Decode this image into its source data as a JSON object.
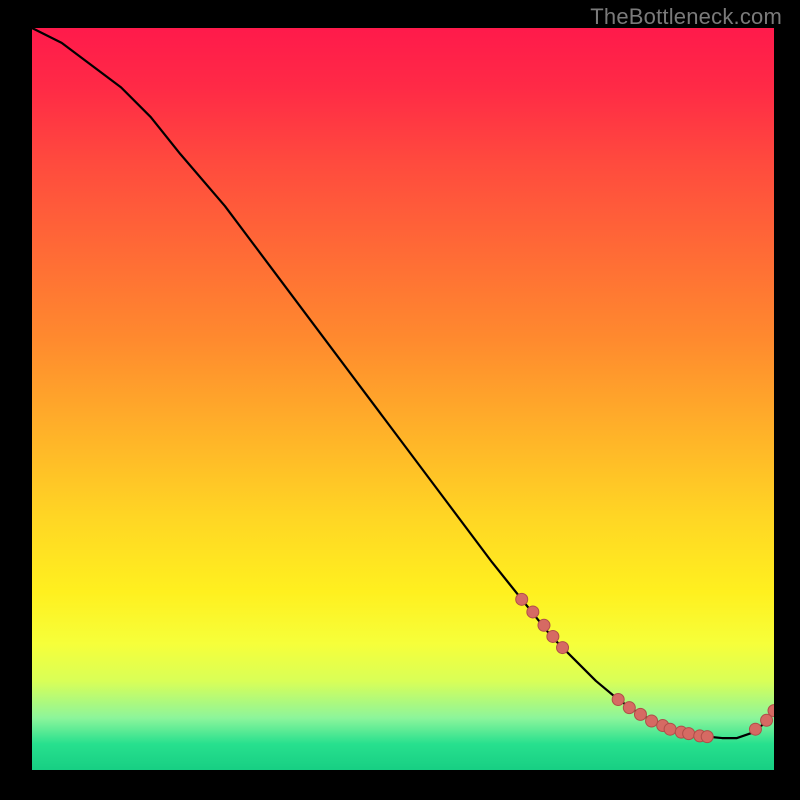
{
  "watermark": "TheBottleneck.com",
  "colors": {
    "curve": "#000000",
    "marker_fill": "#d66a63",
    "marker_stroke": "#b04e49"
  },
  "chart_data": {
    "type": "line",
    "title": "",
    "xlabel": "",
    "ylabel": "",
    "xlim": [
      0,
      100
    ],
    "ylim": [
      0,
      100
    ],
    "series": [
      {
        "name": "bottleneck-curve",
        "x": [
          0,
          4,
          8,
          12,
          16,
          20,
          26,
          32,
          38,
          44,
          50,
          56,
          62,
          66,
          70,
          73,
          76,
          79,
          82,
          85,
          88,
          91,
          93,
          95,
          97,
          99,
          100
        ],
        "y": [
          100,
          98,
          95,
          92,
          88,
          83,
          76,
          68,
          60,
          52,
          44,
          36,
          28,
          23,
          18,
          15,
          12,
          9.5,
          7.5,
          6,
          5,
          4.5,
          4.3,
          4.3,
          5,
          6.5,
          8
        ]
      }
    ],
    "markers": {
      "name": "highlighted-points",
      "x": [
        66,
        67.5,
        69,
        70.2,
        71.5,
        79,
        80.5,
        82,
        83.5,
        85,
        86,
        87.5,
        88.5,
        90,
        91,
        97.5,
        99,
        100
      ],
      "y": [
        23,
        21.3,
        19.5,
        18,
        16.5,
        9.5,
        8.4,
        7.5,
        6.6,
        6,
        5.5,
        5.1,
        4.9,
        4.6,
        4.5,
        5.5,
        6.7,
        8
      ]
    }
  }
}
